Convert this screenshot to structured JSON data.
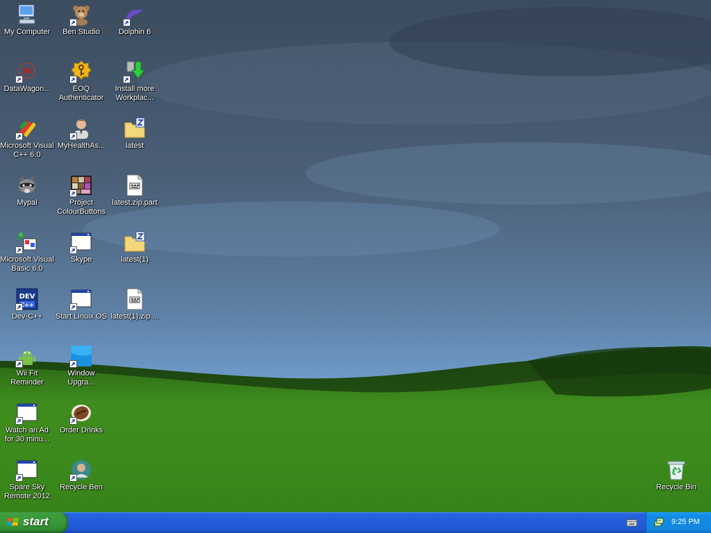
{
  "desktop": {
    "icons": [
      {
        "label": "My Computer",
        "icon": "computer-icon",
        "shortcut": false
      },
      {
        "label": "Ben Studio",
        "icon": "teddy-bear-icon",
        "shortcut": true
      },
      {
        "label": "Dolphin 6",
        "icon": "dolphin-icon",
        "shortcut": true
      },
      {
        "label": "DataWagon...",
        "icon": "datawagon-icon",
        "shortcut": true
      },
      {
        "label": "EOQ\nAuthenticator",
        "icon": "key-badge-icon",
        "shortcut": true
      },
      {
        "label": "Install more\nWorkplac...",
        "icon": "download-arrow-icon",
        "shortcut": true
      },
      {
        "label": "Microsoft Visual\nC++ 6.0",
        "icon": "visual-cpp-icon",
        "shortcut": true
      },
      {
        "label": "MyHealthAs...",
        "icon": "person-icon",
        "shortcut": true
      },
      {
        "label": "latest",
        "icon": "zip-folder-icon",
        "shortcut": false
      },
      {
        "label": "Mypal",
        "icon": "raccoon-icon",
        "shortcut": false
      },
      {
        "label": "Project\nColourButtons",
        "icon": "photo-collage-icon",
        "shortcut": true
      },
      {
        "label": "latest.zip.part",
        "icon": "part-file-icon",
        "shortcut": false
      },
      {
        "label": "Microsoft Visual\nBasic 6.0",
        "icon": "visual-basic-icon",
        "shortcut": true
      },
      {
        "label": "Skype",
        "icon": "window-app-icon",
        "shortcut": true
      },
      {
        "label": "latest(1)",
        "icon": "zip-folder-icon",
        "shortcut": false
      },
      {
        "label": "Dev-C++",
        "icon": "dev-cpp-icon",
        "shortcut": true
      },
      {
        "label": "Start Linuix OS",
        "icon": "window-app-icon",
        "shortcut": true
      },
      {
        "label": "latest(1).zip....",
        "icon": "part-file-icon",
        "shortcut": false
      },
      {
        "label": "Wii Fit\nReminder",
        "icon": "android-icon",
        "shortcut": true
      },
      {
        "label": "Window\nUpgra...",
        "icon": "windows-tile-icon",
        "shortcut": true
      },
      {
        "label": "Watch an Ad\nfor 30 minu...",
        "icon": "window-app-icon",
        "shortcut": true
      },
      {
        "label": "Order Drinks",
        "icon": "coffee-bean-icon",
        "shortcut": true
      },
      {
        "label": "Spare Sky\nRemote 2012",
        "icon": "window-app-icon",
        "shortcut": true
      },
      {
        "label": "Recycle Ben",
        "icon": "person-photo-icon",
        "shortcut": true
      },
      {
        "label": "Recycle Bin",
        "icon": "recycle-bin-icon",
        "shortcut": false
      }
    ]
  },
  "taskbar": {
    "start_label": "start",
    "clock": "9:25 PM"
  },
  "colors": {
    "taskbar": "#245edb",
    "start_button": "#3a9a3a",
    "tray": "#1288e0",
    "label_text": "#ffffff"
  }
}
